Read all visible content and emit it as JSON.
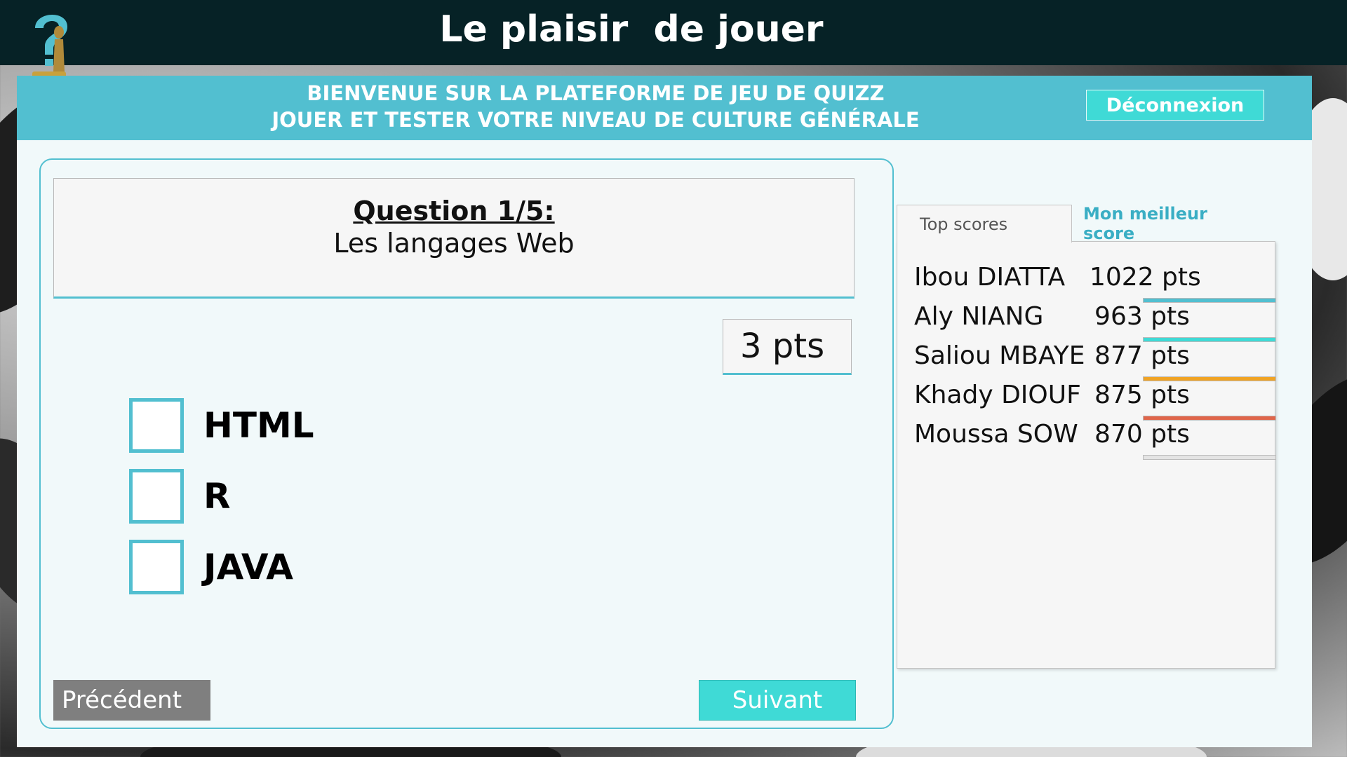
{
  "app": {
    "title": "Le plaisir  de jouer"
  },
  "banner": {
    "line1": "BIENVENUE SUR LA PLATEFORME DE JEU DE QUIZZ",
    "line2": "JOUER ET TESTER VOTRE NIVEAU DE CULTURE GÉNÉRALE",
    "logout_label": "Déconnexion"
  },
  "question": {
    "title": "Question 1/5:",
    "text": "Les langages Web",
    "points": "3 pts",
    "answers": [
      {
        "label": "HTML",
        "checked": false
      },
      {
        "label": "R",
        "checked": false
      },
      {
        "label": "JAVA",
        "checked": false
      }
    ]
  },
  "navigation": {
    "prev_label": "Précédent",
    "next_label": "Suivant"
  },
  "scores": {
    "tabs": [
      {
        "label": "Top scores",
        "active": true
      },
      {
        "label": "Mon meilleur score",
        "active": false
      }
    ],
    "entries": [
      {
        "name": "Ibou DIATTA",
        "points": "1022 pts",
        "bar_fraction": 1.0,
        "bar_color": "#52bfd0"
      },
      {
        "name": "Aly NIANG",
        "points": "963 pts",
        "bar_fraction": 1.0,
        "bar_color": "#3fdad6"
      },
      {
        "name": "Saliou MBAYE",
        "points": "877 pts",
        "bar_fraction": 1.0,
        "bar_color": "#f0a324"
      },
      {
        "name": "Khady DIOUF",
        "points": "875 pts",
        "bar_fraction": 1.0,
        "bar_color": "#e0654a"
      },
      {
        "name": "Moussa SOW",
        "points": "870 pts",
        "bar_fraction": 0.0,
        "bar_color": "#e4e4e4"
      }
    ]
  },
  "colors": {
    "topbar": "#062226",
    "accent": "#52bfd0",
    "button_cyan": "#3fdad6",
    "button_gray": "#7f7f7f"
  }
}
